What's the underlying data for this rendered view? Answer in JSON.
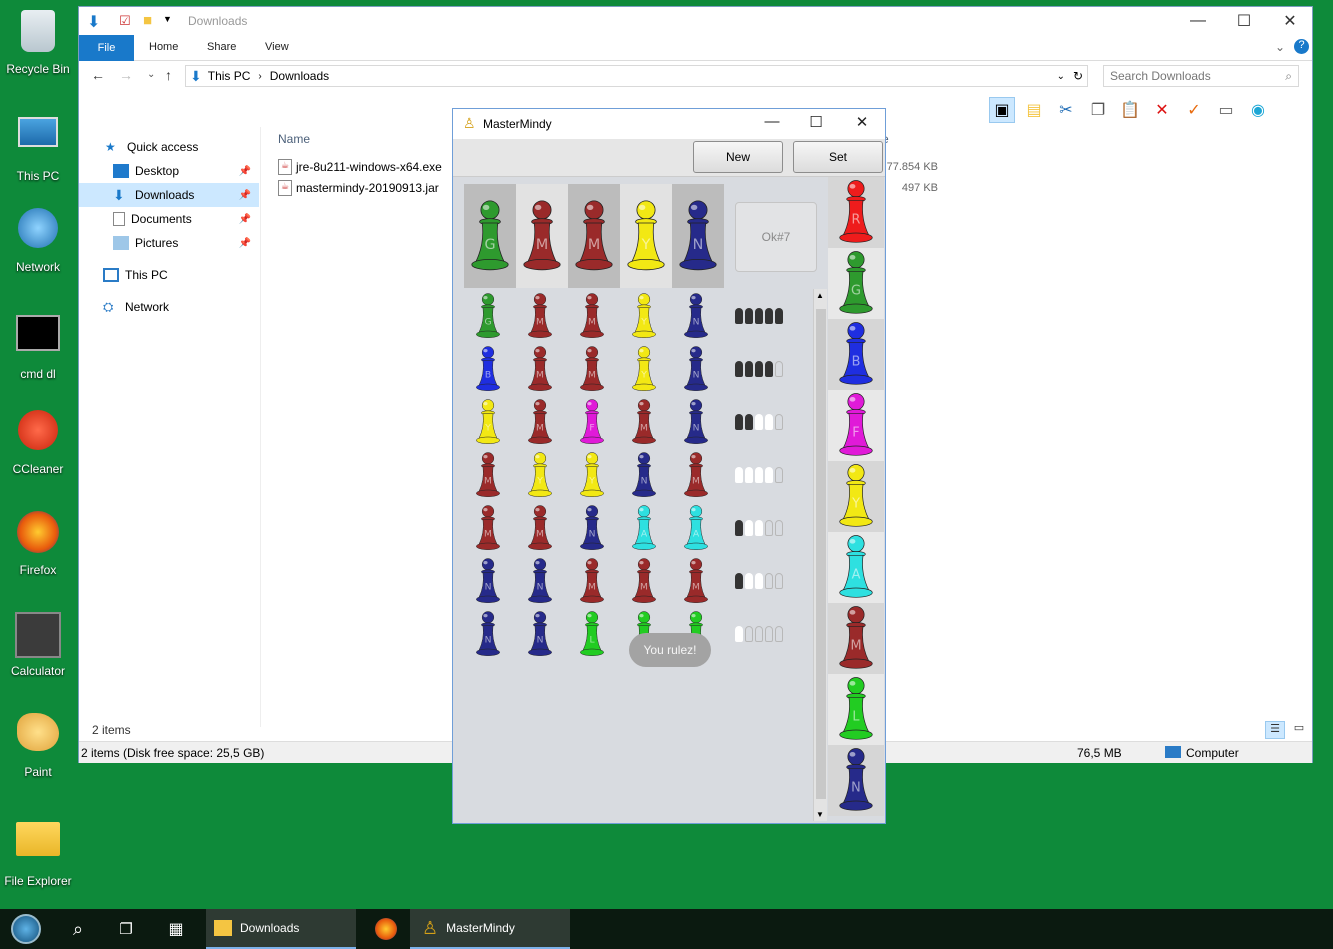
{
  "desktop": {
    "icons": [
      {
        "label": "Recycle Bin",
        "icon": "recycle-bin-icon"
      },
      {
        "label": "This PC",
        "icon": "computer-icon"
      },
      {
        "label": "Network",
        "icon": "network-icon"
      },
      {
        "label": "cmd dl",
        "icon": "cmd-icon"
      },
      {
        "label": "CCleaner",
        "icon": "ccleaner-icon"
      },
      {
        "label": "Firefox",
        "icon": "firefox-icon"
      },
      {
        "label": "Calculator",
        "icon": "calculator-icon"
      },
      {
        "label": "Paint",
        "icon": "paint-icon"
      },
      {
        "label": "File Explorer",
        "icon": "folder-icon"
      }
    ]
  },
  "explorer": {
    "title": "Downloads",
    "ribbon_tabs": [
      "File",
      "Home",
      "Share",
      "View"
    ],
    "breadcrumb": [
      "This PC",
      "Downloads"
    ],
    "search_placeholder": "Search Downloads",
    "nav": {
      "quick_access": "Quick access",
      "items": [
        "Desktop",
        "Downloads",
        "Documents",
        "Pictures"
      ],
      "this_pc": "This PC",
      "network": "Network"
    },
    "column_name": "Name",
    "column_size_partial": "e",
    "files": [
      {
        "name": "jre-8u211-windows-x64.exe",
        "size": "77.854 KB"
      },
      {
        "name": "mastermindy-20190913.jar",
        "size": "497 KB"
      }
    ],
    "item_count": "2 items",
    "status_left": "2 items (Disk free space: 25,5 GB)",
    "status_size": "76,5 MB",
    "status_location": "Computer"
  },
  "mastermindy": {
    "title": "MasterMindy",
    "new_label": "New",
    "set_label": "Set",
    "ok_label": "Ok#7",
    "toast": "You rulez!",
    "colors": {
      "G": "#2e9a2e",
      "M": "#9a2a2a",
      "Y": "#f2e814",
      "N": "#262a8a",
      "B": "#1f2ee0",
      "F": "#e01ad8",
      "A": "#2ee0e0",
      "R": "#ee1c1c",
      "L": "#22cc22"
    },
    "secret": [
      "G",
      "M",
      "M",
      "Y",
      "N"
    ],
    "guesses": [
      {
        "pegs": [
          "G",
          "M",
          "M",
          "Y",
          "N"
        ],
        "feedback": [
          "b",
          "b",
          "b",
          "b",
          "b"
        ]
      },
      {
        "pegs": [
          "B",
          "M",
          "M",
          "Y",
          "N"
        ],
        "feedback": [
          "b",
          "b",
          "b",
          "b",
          "e"
        ]
      },
      {
        "pegs": [
          "Y",
          "M",
          "F",
          "M",
          "N"
        ],
        "feedback": [
          "b",
          "b",
          "w",
          "w",
          "e"
        ]
      },
      {
        "pegs": [
          "M",
          "Y",
          "Y",
          "N",
          "M"
        ],
        "feedback": [
          "w",
          "w",
          "w",
          "w",
          "e"
        ]
      },
      {
        "pegs": [
          "M",
          "M",
          "N",
          "A",
          "A"
        ],
        "feedback": [
          "b",
          "w",
          "w",
          "e",
          "e"
        ]
      },
      {
        "pegs": [
          "N",
          "N",
          "M",
          "M",
          "M"
        ],
        "feedback": [
          "b",
          "w",
          "w",
          "e",
          "e"
        ]
      },
      {
        "pegs": [
          "N",
          "N",
          "L",
          "L",
          "L"
        ],
        "feedback": [
          "w",
          "e",
          "e",
          "e",
          "e"
        ]
      }
    ],
    "palette": [
      "R",
      "G",
      "B",
      "F",
      "Y",
      "A",
      "M",
      "L",
      "N"
    ]
  },
  "taskbar": {
    "items": [
      {
        "label": "Downloads",
        "icon": "folder-icon"
      },
      {
        "label": "MasterMindy",
        "icon": "mastermindy-icon"
      }
    ]
  }
}
